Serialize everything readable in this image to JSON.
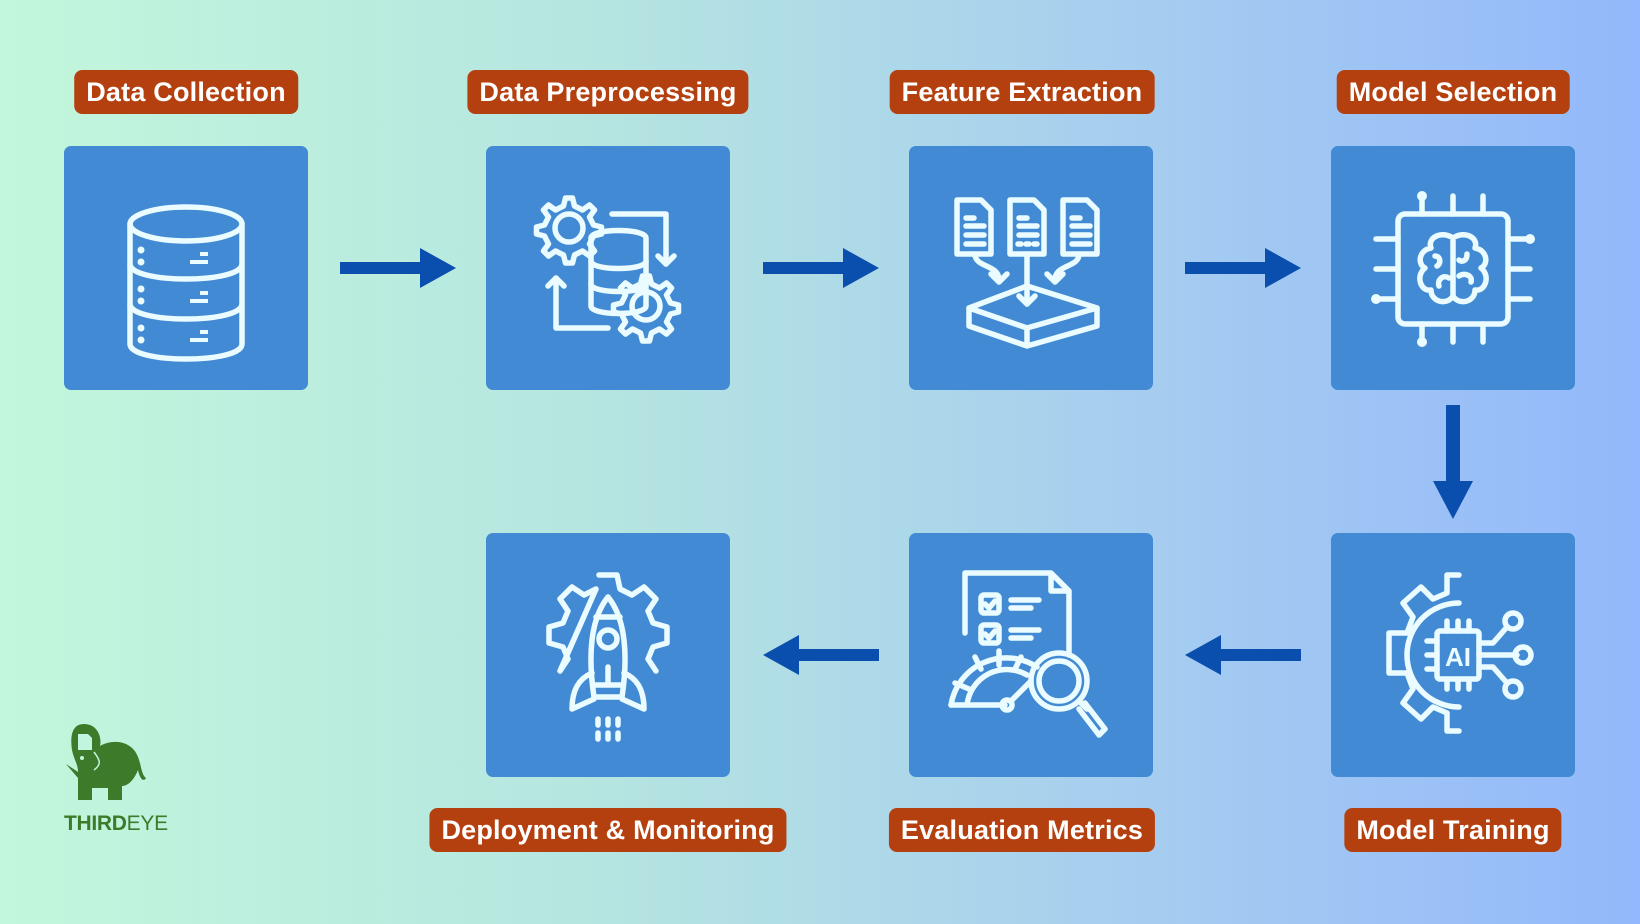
{
  "diagram": {
    "type": "ml-pipeline-flow",
    "steps": [
      {
        "id": 1,
        "label": "Data Collection",
        "icon": "database-icon"
      },
      {
        "id": 2,
        "label": "Data Preprocessing",
        "icon": "data-gears-icon"
      },
      {
        "id": 3,
        "label": "Feature Extraction",
        "icon": "documents-merge-icon"
      },
      {
        "id": 4,
        "label": "Model Selection",
        "icon": "brain-chip-icon"
      },
      {
        "id": 5,
        "label": "Model Training",
        "icon": "ai-gear-icon"
      },
      {
        "id": 6,
        "label": "Evaluation Metrics",
        "icon": "checklist-gauge-magnifier-icon"
      },
      {
        "id": 7,
        "label": "Deployment & Monitoring",
        "icon": "rocket-gear-icon"
      }
    ],
    "edges": [
      {
        "from": 1,
        "to": 2,
        "direction": "right"
      },
      {
        "from": 2,
        "to": 3,
        "direction": "right"
      },
      {
        "from": 3,
        "to": 4,
        "direction": "right"
      },
      {
        "from": 4,
        "to": 5,
        "direction": "down"
      },
      {
        "from": 5,
        "to": 6,
        "direction": "left"
      },
      {
        "from": 6,
        "to": 7,
        "direction": "left"
      }
    ]
  },
  "brand": {
    "name_bold": "THIRD",
    "name_light": "EYE",
    "logo": "elephant-icon"
  },
  "colors": {
    "label_bg": "#b5400f",
    "box_bg": "#428bd4",
    "arrow": "#0a4fad",
    "icon": "#eafcff",
    "brand": "#3d7a2a"
  }
}
